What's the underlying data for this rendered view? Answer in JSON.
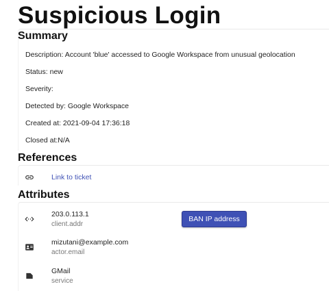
{
  "page": {
    "title": "Suspicious Login"
  },
  "summary": {
    "heading": "Summary",
    "description": "Description: Account 'blue' accessed to Google Workspace from unusual geolocation",
    "status": "Status: new",
    "severity": "Severity:",
    "detected_by": "Detected by: Google Workspace",
    "created_at": "Created at: 2021-09-04 17:36:18",
    "closed_at": "Closed at:N/A"
  },
  "references": {
    "heading": "References",
    "items": [
      {
        "icon": "link-icon",
        "label": "Link to ticket"
      }
    ]
  },
  "attributes": {
    "heading": "Attributes",
    "items": [
      {
        "icon": "code-icon",
        "value": "203.0.113.1",
        "key": "client.addr",
        "action_label": "BAN IP address"
      },
      {
        "icon": "contact-card-icon",
        "value": "mizutani@example.com",
        "key": "actor.email"
      },
      {
        "icon": "label-icon",
        "value": "GMail",
        "key": "service"
      }
    ]
  },
  "colors": {
    "accent": "#3f51b5",
    "link": "#3f51b5",
    "muted_text": "#777777"
  }
}
